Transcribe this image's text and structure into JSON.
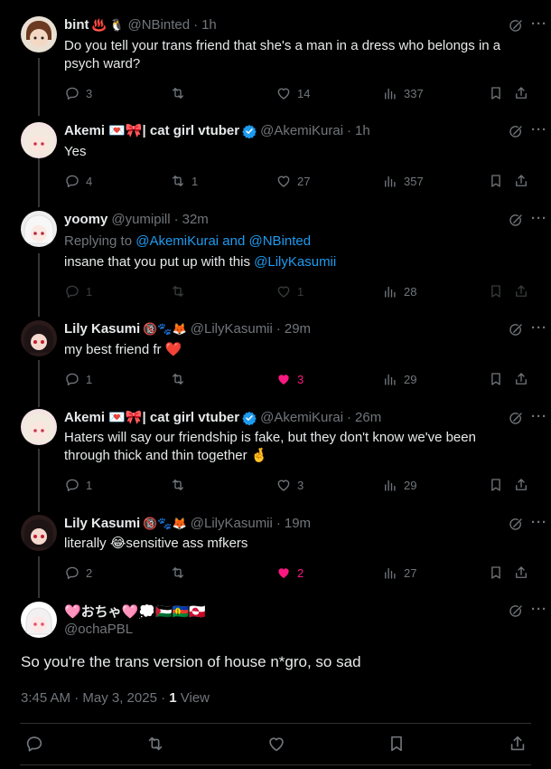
{
  "posts": [
    {
      "name": "bint",
      "emoji": "♨️ 🐧",
      "handle": "@NBinted",
      "time": "1h",
      "verified": false,
      "text": "Do you tell your trans friend that she's a man in a dress who belongs in a psych ward?",
      "replies": "3",
      "reposts": "",
      "likes": "14",
      "views": "337"
    },
    {
      "name": "Akemi 💌🎀| cat girl vtuber",
      "handle": "@AkemiKurai",
      "time": "1h",
      "verified": true,
      "text": "Yes",
      "replies": "4",
      "reposts": "1",
      "likes": "27",
      "views": "357"
    },
    {
      "name": "yoomy",
      "handle": "@yumipill",
      "time": "32m",
      "verified": false,
      "replying_prefix": "Replying to",
      "replying_to": "@AkemiKurai and @NBinted",
      "text": "insane that you put up with this",
      "text_mention": "@LilyKasumii",
      "replies": "1",
      "reposts": "",
      "likes": "1",
      "views": "28"
    },
    {
      "name": "Lily Kasumi",
      "emoji": "🔞🐾🦊",
      "handle": "@LilyKasumii",
      "time": "29m",
      "verified": false,
      "text": "my best friend fr ❤️",
      "replies": "1",
      "reposts": "",
      "likes": "3",
      "views": "29"
    },
    {
      "name": "Akemi 💌🎀| cat girl vtuber",
      "handle": "@AkemiKurai",
      "time": "26m",
      "verified": true,
      "text": "Haters will say our friendship is fake, but they don't know we've been through thick and thin together 🤞",
      "replies": "1",
      "reposts": "",
      "likes": "3",
      "views": "29"
    },
    {
      "name": "Lily Kasumi",
      "emoji": "🔞🐾🦊",
      "handle": "@LilyKasumii",
      "time": "19m",
      "verified": false,
      "text": "literally 😂sensitive ass mfkers",
      "replies": "2",
      "reposts": "",
      "likes": "2",
      "views": "27"
    }
  ],
  "main": {
    "name": "🩷おちゃ🩷💭🇵🇸🇳🇨🇬🇱",
    "handle": "@ochaPBL",
    "text": "So you're the trans version of house n*gro, so sad",
    "timestamp": "3:45 AM · May 3, 2025 ·",
    "views_count": "1",
    "views_label": "View"
  },
  "colors": {
    "accent": "#1d9bf0",
    "like": "#f91880",
    "muted": "#71767b"
  }
}
